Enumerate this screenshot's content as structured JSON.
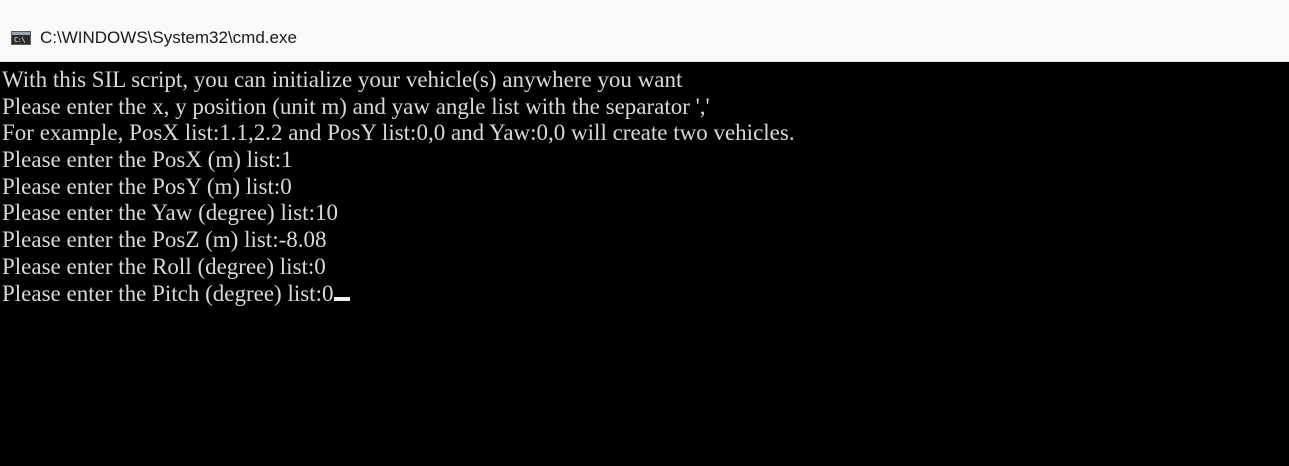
{
  "window": {
    "title": "C:\\WINDOWS\\System32\\cmd.exe",
    "icon": "cmd-icon"
  },
  "console": {
    "lines": [
      "With this SIL script, you can initialize your vehicle(s) anywhere you want",
      "Please enter the x, y position (unit m) and yaw angle list with the separator ','",
      "For example, PosX list:1.1,2.2 and PosY list:0,0 and Yaw:0,0 will create two vehicles.",
      "Please enter the PosX (m) list:1",
      "Please enter the PosY (m) list:0",
      "Please enter the Yaw (degree) list:10",
      "Please enter the PosZ (m) list:-8.08",
      "Please enter the Roll (degree) list:0",
      "Please enter the Pitch (degree) list:0"
    ]
  },
  "colors": {
    "console_background": "#000000",
    "console_text": "#d9d9d9",
    "titlebar_background": "#f9f9f9"
  }
}
